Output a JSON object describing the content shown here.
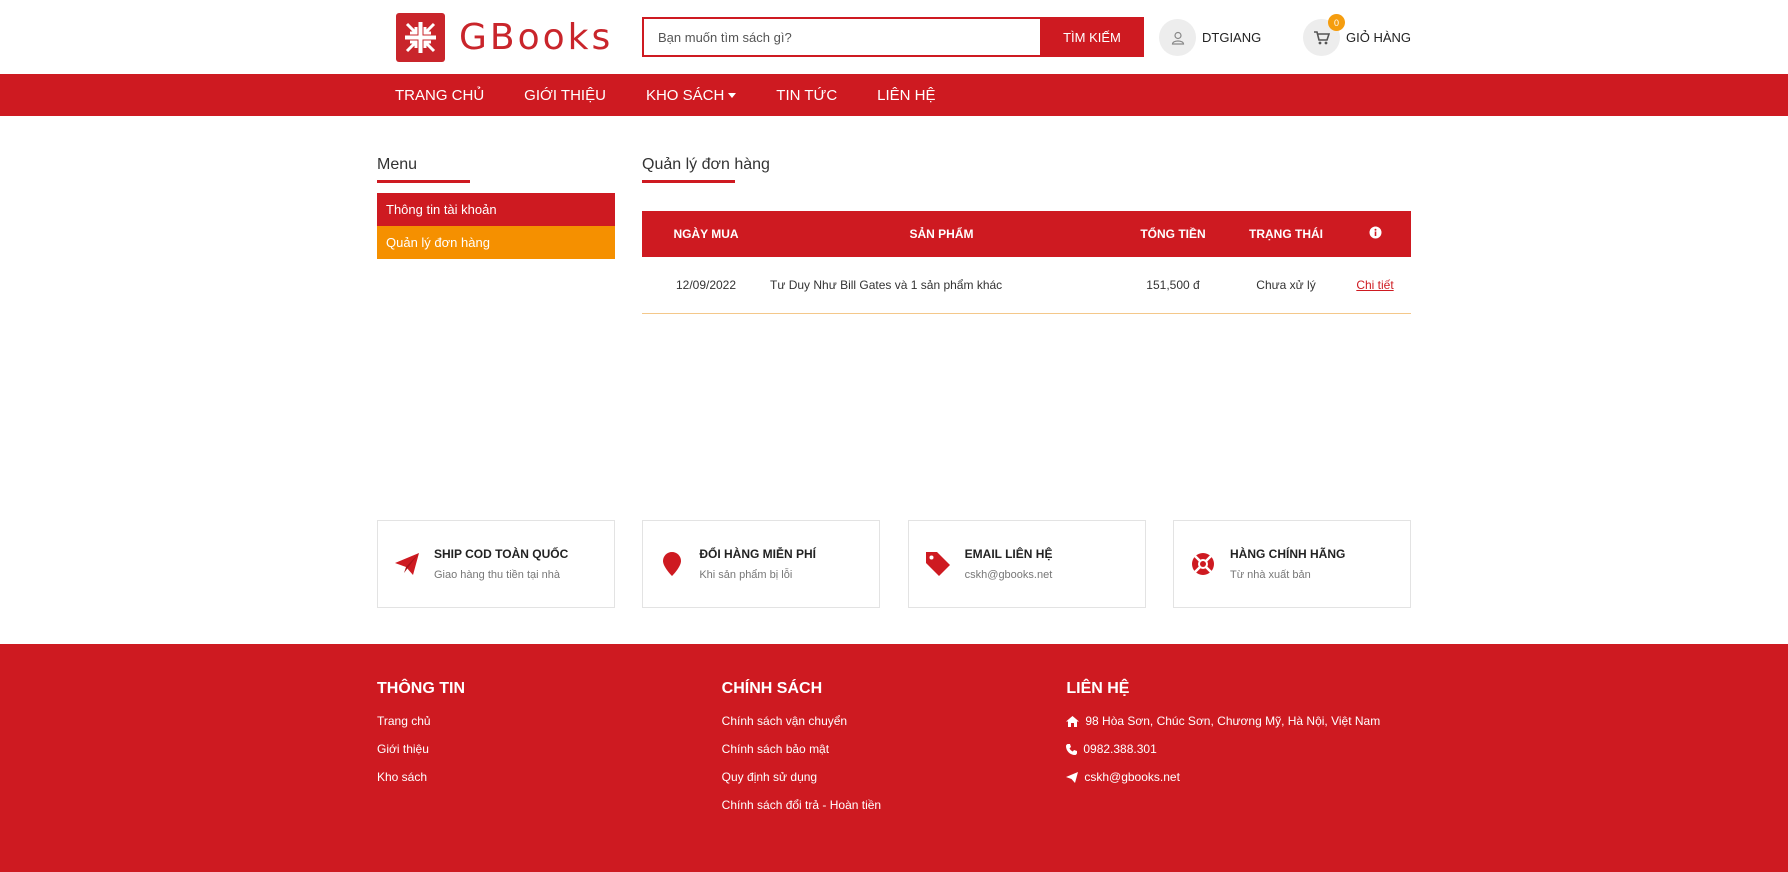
{
  "brand": {
    "name": "GBooks",
    "accent": "#ce1a21",
    "orange": "#f59000"
  },
  "search": {
    "placeholder": "Bạn muốn tìm sách gì?",
    "button": "TÌM KIẾM"
  },
  "user": {
    "name": "DTGIANG",
    "icon": "user-icon"
  },
  "cart": {
    "label": "GIỎ HÀNG",
    "count": "0",
    "icon": "cart-icon"
  },
  "nav": {
    "items": [
      "TRANG CHỦ",
      "GIỚI THIỆU",
      "KHO SÁCH",
      "TIN TỨC",
      "LIÊN HỆ"
    ]
  },
  "sidebar": {
    "title": "Menu",
    "items": [
      "Thông tin tài khoản",
      "Quản lý đơn hàng"
    ]
  },
  "orders": {
    "title": "Quản lý đơn hàng",
    "headers": [
      "NGÀY MUA",
      "SẢN PHẨM",
      "TỔNG TIỀN",
      "TRẠNG THÁI"
    ],
    "rows": [
      {
        "date": "12/09/2022",
        "product": "Tư Duy Như Bill Gates và 1 sản phẩm khác",
        "total": "151,500 đ",
        "status": "Chưa xử lý",
        "action": "Chi tiết"
      }
    ]
  },
  "features": [
    {
      "title": "SHIP COD TOÀN QUỐC",
      "sub": "Giao hàng thu tiền tại nhà",
      "icon": "paper-plane-icon"
    },
    {
      "title": "ĐỔI HÀNG MIỄN PHÍ",
      "sub": "Khi sản phẩm bị lỗi",
      "icon": "map-pin-icon"
    },
    {
      "title": "EMAIL LIÊN HỆ",
      "sub": "cskh@gbooks.net",
      "icon": "tag-icon"
    },
    {
      "title": "HÀNG CHÍNH HÃNG",
      "sub": "Từ nhà xuất bản",
      "icon": "life-ring-icon"
    }
  ],
  "footer": {
    "info": {
      "title": "THÔNG TIN",
      "links": [
        "Trang chủ",
        "Giới thiệu",
        "Kho sách"
      ]
    },
    "policy": {
      "title": "CHÍNH SÁCH",
      "links": [
        "Chính sách vận chuyển",
        "Chính sách bảo mật",
        "Quy định sử dụng",
        "Chính sách đổi trả - Hoàn tiền"
      ]
    },
    "contact": {
      "title": "LIÊN HỆ",
      "address": "98 Hòa Sơn, Chúc Sơn, Chương Mỹ, Hà Nội, Việt Nam",
      "phone": "0982.388.301",
      "email": "cskh@gbooks.net"
    }
  }
}
